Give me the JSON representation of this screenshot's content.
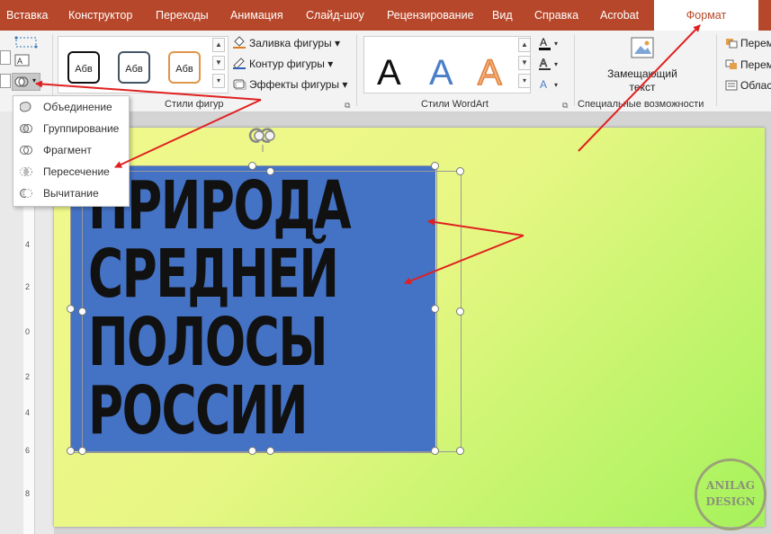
{
  "tabs": [
    "Вставка",
    "Конструктор",
    "Переходы",
    "Анимация",
    "Слайд-шоу",
    "Рецензирование",
    "Вид",
    "Справка",
    "Acrobat",
    "Формат"
  ],
  "colors": {
    "tab_bar": "#b7472a",
    "active_tab_text": "#b7472a",
    "blue_shape": "#4472c4",
    "arrow": "#e02020"
  },
  "ribbon": {
    "shape_styles": {
      "thumbnails": [
        "Абв",
        "Абв",
        "Абв"
      ],
      "fill": "Заливка фигуры",
      "outline": "Контур фигуры",
      "effects": "Эффекты фигуры",
      "group_label": "Стили фигур"
    },
    "wordart": {
      "letters": [
        "A",
        "A",
        "A"
      ],
      "group_label": "Стили WordArt"
    },
    "accessibility": {
      "alt_text_line1": "Замещающий",
      "alt_text_line2": "текст",
      "group_label": "Специальные возможности"
    },
    "arrange": {
      "items": [
        "Перем",
        "Перем",
        "Облас"
      ]
    }
  },
  "merge_menu": {
    "items": [
      "Объединение",
      "Группирование",
      "Фрагмент",
      "Пересечение",
      "Вычитание"
    ]
  },
  "ruler_labels": [
    "4",
    "2",
    "0",
    "2",
    "4",
    "6",
    "8"
  ],
  "slide": {
    "text_lines": [
      "ПРИРОДА",
      "СРЕДНЕЙ",
      "ПОЛОСЫ",
      "РОССИИ"
    ]
  },
  "watermark": {
    "line1": "ANILAG",
    "line2": "DESIGN"
  }
}
